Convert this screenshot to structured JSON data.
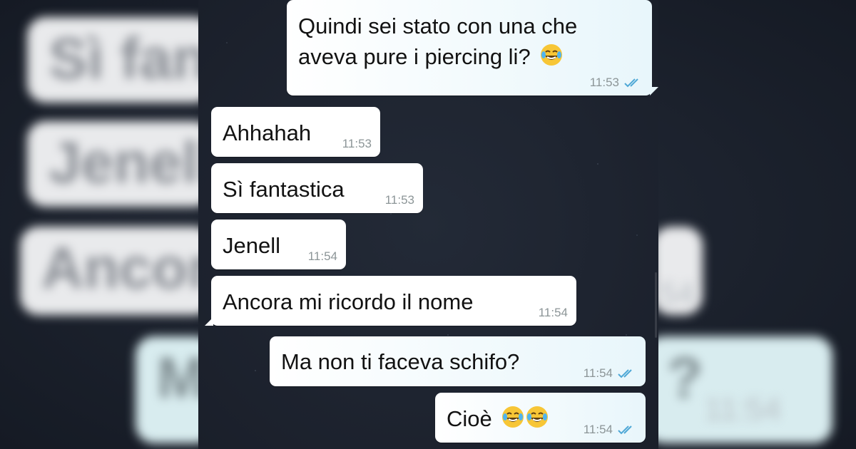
{
  "colors": {
    "incoming_bubble": "#ffffff",
    "outgoing_bubble": "#e8f6fb",
    "read_ticks": "#4fa8d6",
    "timestamp": "#8c9597",
    "wallpaper": "#1a1f2a"
  },
  "chat": {
    "messages": [
      {
        "direction": "outgoing",
        "text_line1": "Quindi sei stato con una che",
        "text_line2": "aveva pure i piercing li?",
        "emoji": [
          "face-with-tears-of-joy-icon"
        ],
        "time": "11:53",
        "status_icon": "double-check-read-icon"
      },
      {
        "direction": "incoming",
        "text": "Ahhahah",
        "time": "11:53"
      },
      {
        "direction": "incoming",
        "text": "Sì fantastica",
        "time": "11:53"
      },
      {
        "direction": "incoming",
        "text": "Jenell",
        "time": "11:54"
      },
      {
        "direction": "incoming",
        "text": "Ancora mi ricordo il nome",
        "time": "11:54"
      },
      {
        "direction": "outgoing",
        "text": "Ma non ti faceva schifo?",
        "time": "11:54",
        "status_icon": "double-check-read-icon"
      },
      {
        "direction": "outgoing",
        "text": "Cioè",
        "emoji": [
          "face-with-tears-of-joy-icon",
          "face-with-tears-of-joy-icon"
        ],
        "time": "11:54",
        "status_icon": "double-check-read-icon"
      }
    ]
  },
  "background_blur": {
    "left": [
      "Sì fanta",
      "Jenell",
      "Ancora"
    ],
    "right_fragment": "?",
    "right_time": "11:54",
    "left_time": "54",
    "bottom_left_fragment": "M"
  }
}
